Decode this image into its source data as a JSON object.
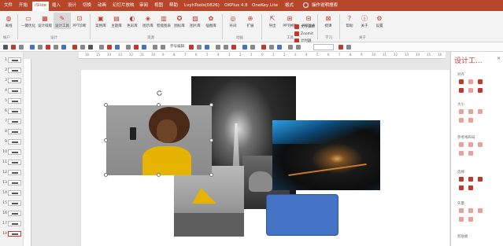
{
  "menu": {
    "tabs": [
      "文件",
      "开始",
      "iSlide",
      "插入",
      "设计",
      "切换",
      "动画",
      "幻灯片放映",
      "审阅",
      "视图",
      "帮助",
      "LvyhTools(0826)",
      "OKPlus 4.8",
      "OneKey Lite",
      "格式"
    ],
    "active_tab": "iSlide",
    "tell_me": "操作说明搜索"
  },
  "ribbon": {
    "buttons": [
      "离线",
      "一键优化",
      "设计排版",
      "设计工具",
      "PPT诊断",
      "案例库",
      "主题库",
      "色彩库",
      "图示库",
      "智能图表",
      "图标库",
      "图片库",
      "插图库",
      "补间",
      "扩展",
      "导出",
      "PPT拼图",
      "PPT瘦身",
      "授课",
      "帮助",
      "关于",
      "设置"
    ],
    "small_buttons": [
      "文件分析",
      "Zoomit",
      "计时器"
    ],
    "groups": [
      "帐户",
      "设计",
      "资源",
      "动画",
      "工具",
      "学习",
      "关于"
    ]
  },
  "toolbar2": {
    "fields": [
      "字号编辑",
      ""
    ]
  },
  "ruler": {
    "ticks": [
      "16",
      "15",
      "14",
      "13",
      "12",
      "11",
      "10",
      "9",
      "8",
      "7",
      "6",
      "5",
      "4",
      "3",
      "2",
      "1",
      "0",
      "1",
      "2",
      "3",
      "4",
      "5",
      "6",
      "7",
      "8",
      "9",
      "10",
      "11",
      "12",
      "13",
      "14",
      "15",
      "16"
    ]
  },
  "thumbnails": {
    "numbers": [
      "1",
      "2",
      "3",
      "4",
      "5",
      "6",
      "7",
      "8",
      "9",
      "10",
      "11",
      "12",
      "13",
      "14",
      "15",
      "16",
      "17",
      "18"
    ],
    "selected": "18"
  },
  "panel": {
    "title": "设计工...",
    "sections": [
      "对齐",
      "大小",
      "参考线布局",
      "选择",
      "矢量",
      "剪贴板"
    ]
  },
  "colors": {
    "accent": "#b7472a",
    "shape": "#4472c4",
    "photo_yellow": "#e6b400"
  }
}
